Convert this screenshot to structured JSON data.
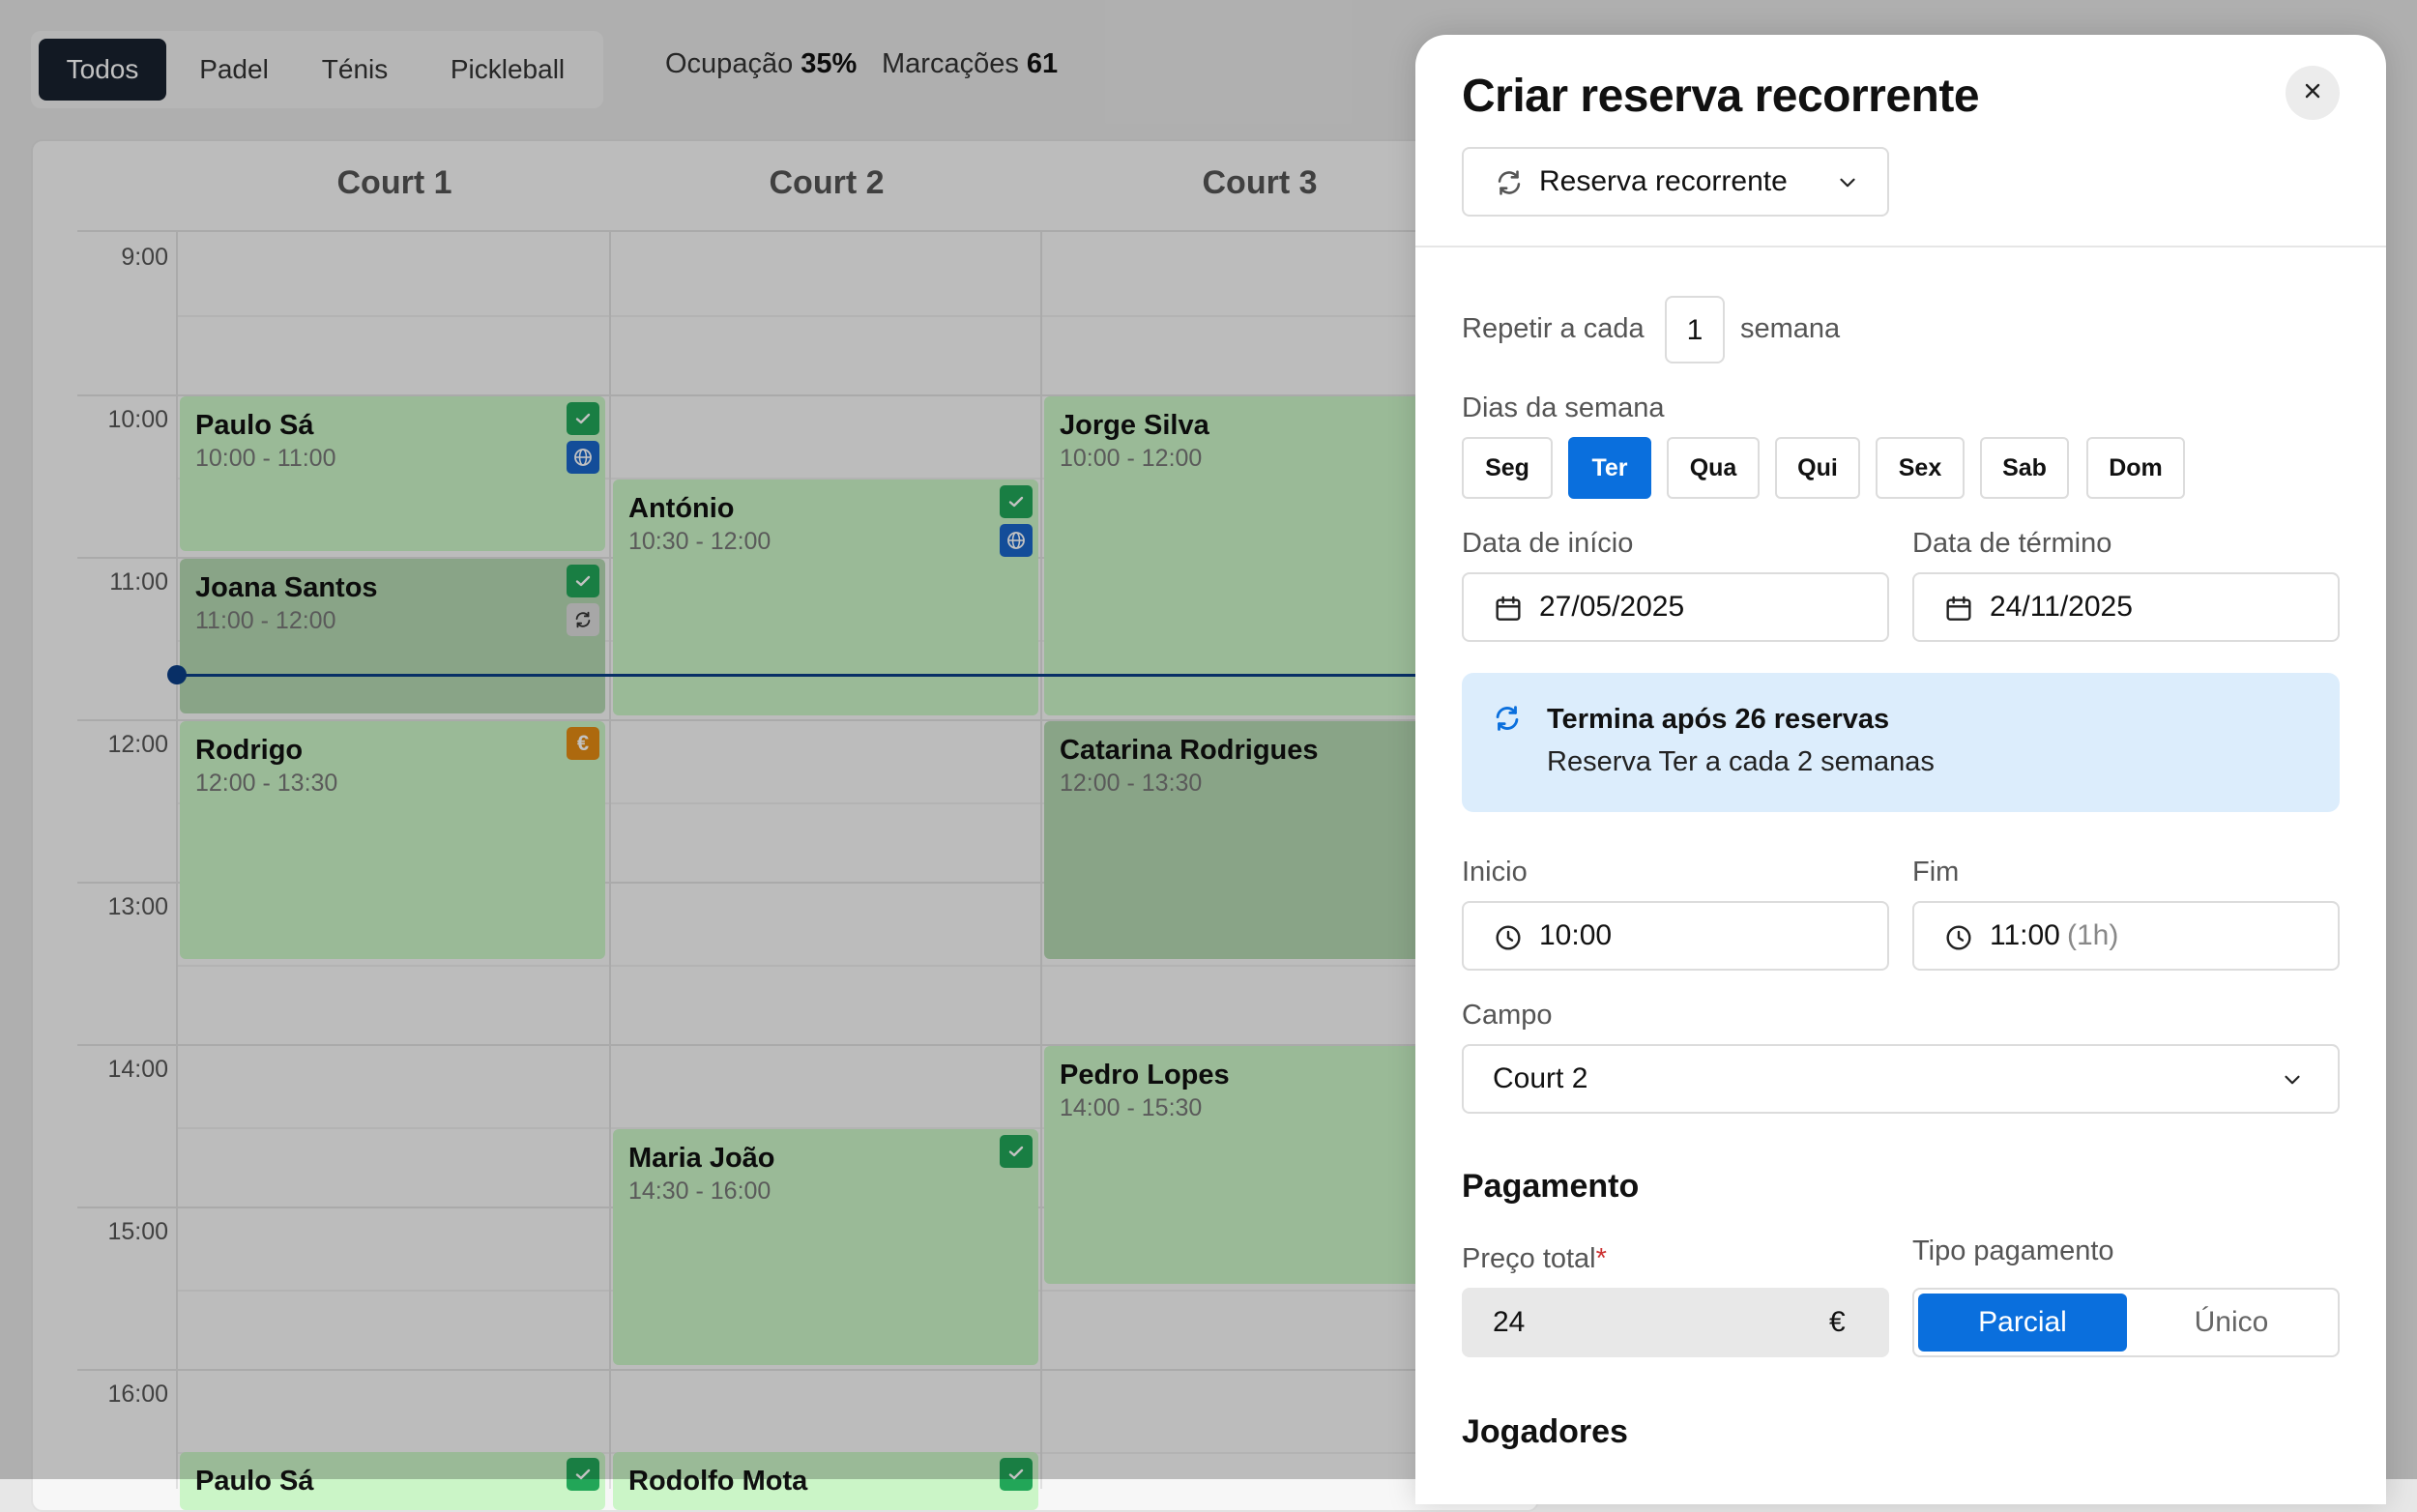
{
  "filters": {
    "items": [
      "Todos",
      "Padel",
      "Ténis",
      "Pickleball"
    ],
    "active": "Todos"
  },
  "stats": {
    "occupancy_label": "Ocupação",
    "occupancy_value": "35%",
    "bookings_label": "Marcações",
    "bookings_value": "61"
  },
  "calendar": {
    "courts": [
      "Court 1",
      "Court 2",
      "Court 3"
    ],
    "times": [
      "9:00",
      "10:00",
      "11:00",
      "12:00",
      "13:00",
      "14:00",
      "15:00",
      "16:00"
    ],
    "events": [
      {
        "name": "Paulo Sá",
        "time": "10:00 - 11:00",
        "icons": [
          "check-icon",
          "globe-icon"
        ]
      },
      {
        "name": "Joana Santos",
        "time": "11:00 - 12:00",
        "icons": [
          "check-icon",
          "recurring-icon"
        ]
      },
      {
        "name": "Rodrigo",
        "time": "12:00 - 13:30",
        "icons": [
          "euro-icon"
        ]
      },
      {
        "name": "Paulo Sá",
        "time": "",
        "icons": [
          "check-icon"
        ]
      },
      {
        "name": "António",
        "time": "10:30 - 12:00",
        "icons": [
          "check-icon",
          "globe-icon"
        ]
      },
      {
        "name": "Maria João",
        "time": "14:30 - 16:00",
        "icons": [
          "check-icon"
        ]
      },
      {
        "name": "Rodolfo Mota",
        "time": "",
        "icons": [
          "check-icon"
        ]
      },
      {
        "name": "Jorge Silva",
        "time": "10:00 - 12:00",
        "icons": []
      },
      {
        "name": "Catarina Rodrigues",
        "time": "12:00 - 13:30",
        "icons": []
      },
      {
        "name": "Pedro Lopes",
        "time": "14:00 - 15:30",
        "icons": []
      }
    ],
    "euro_symbol": "€"
  },
  "modal": {
    "title": "Criar reserva recorrente",
    "type_select": "Reserva recorrente",
    "repeat_label": "Repetir a cada",
    "repeat_value": "1",
    "repeat_unit": "semana",
    "weekdays_label": "Dias da semana",
    "weekdays": [
      "Seg",
      "Ter",
      "Qua",
      "Qui",
      "Sex",
      "Sab",
      "Dom"
    ],
    "weekday_selected": "Ter",
    "start_date_label": "Data de início",
    "start_date": "27/05/2025",
    "end_date_label": "Data de término",
    "end_date": "24/11/2025",
    "info_title": "Termina após 26 reservas",
    "info_text": "Reserva Ter a cada 2 semanas",
    "start_label": "Inicio",
    "start_time": "10:00",
    "end_label": "Fim",
    "end_time": "11:00",
    "end_duration": "(1h)",
    "court_label": "Campo",
    "court_value": "Court 2",
    "payment_title": "Pagamento",
    "price_label": "Preço total",
    "price_required": "*",
    "price_value": "24",
    "currency": "€",
    "payment_type_label": "Tipo pagamento",
    "payment_options": [
      "Parcial",
      "Único"
    ],
    "payment_selected": "Parcial",
    "players_title": "Jogadores"
  },
  "colors": {
    "accent": "#0a6fdd",
    "booking_green": "#cbf5c7",
    "dark_pill": "#18212f",
    "info_bg": "#dcedfc",
    "now_line": "#0b3f86"
  }
}
